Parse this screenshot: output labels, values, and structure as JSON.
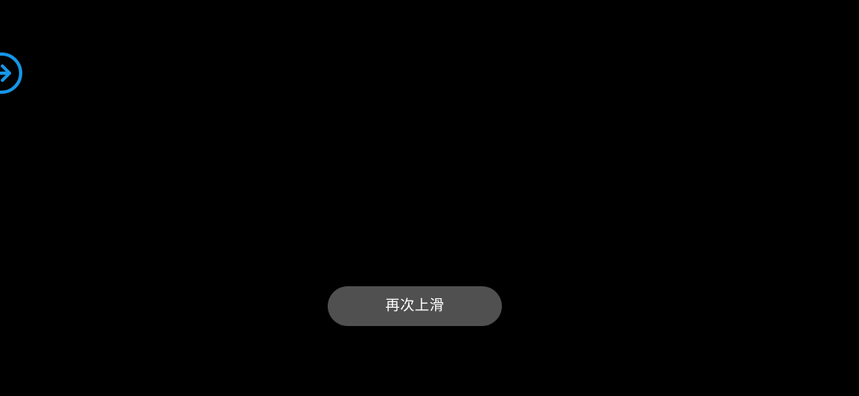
{
  "screen": {
    "background_color": "#000000"
  },
  "nav": {
    "forward_icon": "arrow-right-circle-icon",
    "accent_color": "#1796e8"
  },
  "toast": {
    "text": "再次上滑",
    "background_color": "#505050",
    "text_color": "#ffffff"
  }
}
